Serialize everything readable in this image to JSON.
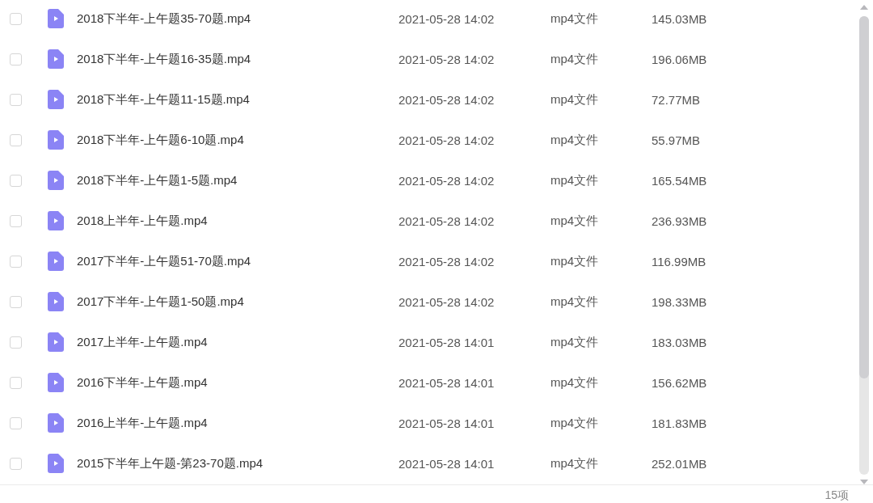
{
  "files": [
    {
      "name": "2018下半年-上午题35-70题.mp4",
      "modified": "2021-05-28 14:02",
      "type": "mp4文件",
      "size": "145.03MB",
      "checked": false
    },
    {
      "name": "2018下半年-上午题16-35题.mp4",
      "modified": "2021-05-28 14:02",
      "type": "mp4文件",
      "size": "196.06MB",
      "checked": false
    },
    {
      "name": "2018下半年-上午题11-15题.mp4",
      "modified": "2021-05-28 14:02",
      "type": "mp4文件",
      "size": "72.77MB",
      "checked": false
    },
    {
      "name": "2018下半年-上午题6-10题.mp4",
      "modified": "2021-05-28 14:02",
      "type": "mp4文件",
      "size": "55.97MB",
      "checked": false
    },
    {
      "name": "2018下半年-上午题1-5题.mp4",
      "modified": "2021-05-28 14:02",
      "type": "mp4文件",
      "size": "165.54MB",
      "checked": false
    },
    {
      "name": "2018上半年-上午题.mp4",
      "modified": "2021-05-28 14:02",
      "type": "mp4文件",
      "size": "236.93MB",
      "checked": false
    },
    {
      "name": "2017下半年-上午题51-70题.mp4",
      "modified": "2021-05-28 14:02",
      "type": "mp4文件",
      "size": "116.99MB",
      "checked": false
    },
    {
      "name": "2017下半年-上午题1-50题.mp4",
      "modified": "2021-05-28 14:02",
      "type": "mp4文件",
      "size": "198.33MB",
      "checked": false
    },
    {
      "name": "2017上半年-上午题.mp4",
      "modified": "2021-05-28 14:01",
      "type": "mp4文件",
      "size": "183.03MB",
      "checked": false
    },
    {
      "name": "2016下半年-上午题.mp4",
      "modified": "2021-05-28 14:01",
      "type": "mp4文件",
      "size": "156.62MB",
      "checked": false
    },
    {
      "name": "2016上半年-上午题.mp4",
      "modified": "2021-05-28 14:01",
      "type": "mp4文件",
      "size": "181.83MB",
      "checked": false
    },
    {
      "name": "2015下半年上午题-第23-70题.mp4",
      "modified": "2021-05-28 14:01",
      "type": "mp4文件",
      "size": "252.01MB",
      "checked": false
    }
  ],
  "status_bar": {
    "count": "15项"
  }
}
